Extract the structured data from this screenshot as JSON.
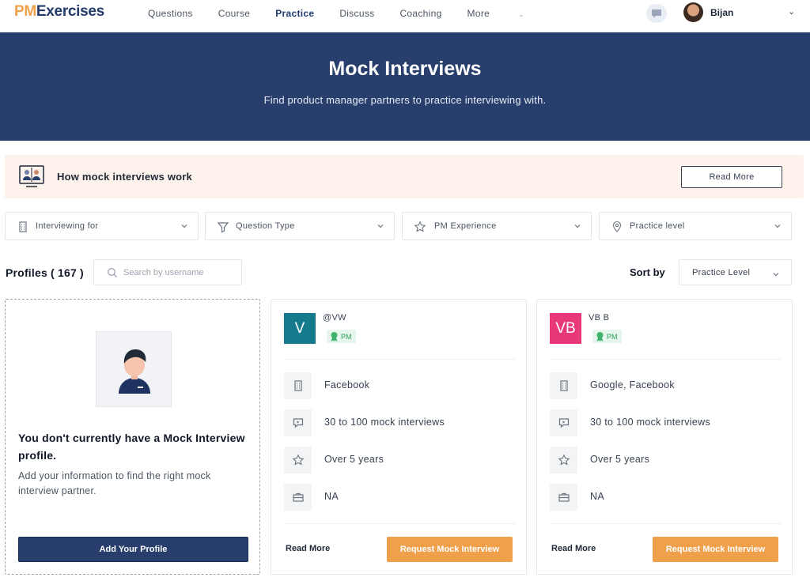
{
  "nav": {
    "logo_pm": "PM",
    "logo_rest": "Exercises",
    "links": [
      "Questions",
      "Course",
      "Practice",
      "Discuss",
      "Coaching",
      "More"
    ],
    "active": "Practice",
    "user_name": "Bijan"
  },
  "hero": {
    "title": "Mock Interviews",
    "subtitle": "Find product manager partners to practice interviewing with."
  },
  "banner": {
    "title": "How mock interviews work",
    "button": "Read More"
  },
  "filters": [
    {
      "label": "Interviewing for",
      "icon": "building-icon"
    },
    {
      "label": "Question Type",
      "icon": "funnel-icon"
    },
    {
      "label": "PM Experience",
      "icon": "star-icon"
    },
    {
      "label": "Practice level",
      "icon": "location-pin-icon"
    }
  ],
  "profiles": {
    "title": "Profiles ( 167 )",
    "search_placeholder": "Search by username",
    "sort_label": "Sort by",
    "sort_value": "Practice Level"
  },
  "empty_card": {
    "title": "You don't currently have a Mock Interview profile.",
    "description": "Add your information to find the right mock interview partner.",
    "button": "Add Your Profile"
  },
  "cards": [
    {
      "initials": "V",
      "username": "@VW",
      "badge": "PM",
      "avatar_color": "#157a8c",
      "companies": "Facebook",
      "interviews": "30 to 100 mock interviews",
      "experience": "Over 5 years",
      "role": "NA",
      "read_more": "Read More",
      "request": "Request Mock Interview"
    },
    {
      "initials": "VB",
      "username": "VB B",
      "badge": "PM",
      "avatar_color": "#e8387a",
      "companies": "Google, Facebook",
      "interviews": "30 to 100 mock interviews",
      "experience": "Over 5 years",
      "role": "NA",
      "read_more": "Read More",
      "request": "Request Mock Interview"
    }
  ],
  "colors": {
    "navy": "#283f6d",
    "orange": "#f0a04b",
    "banner_bg": "#fdf2ec"
  }
}
